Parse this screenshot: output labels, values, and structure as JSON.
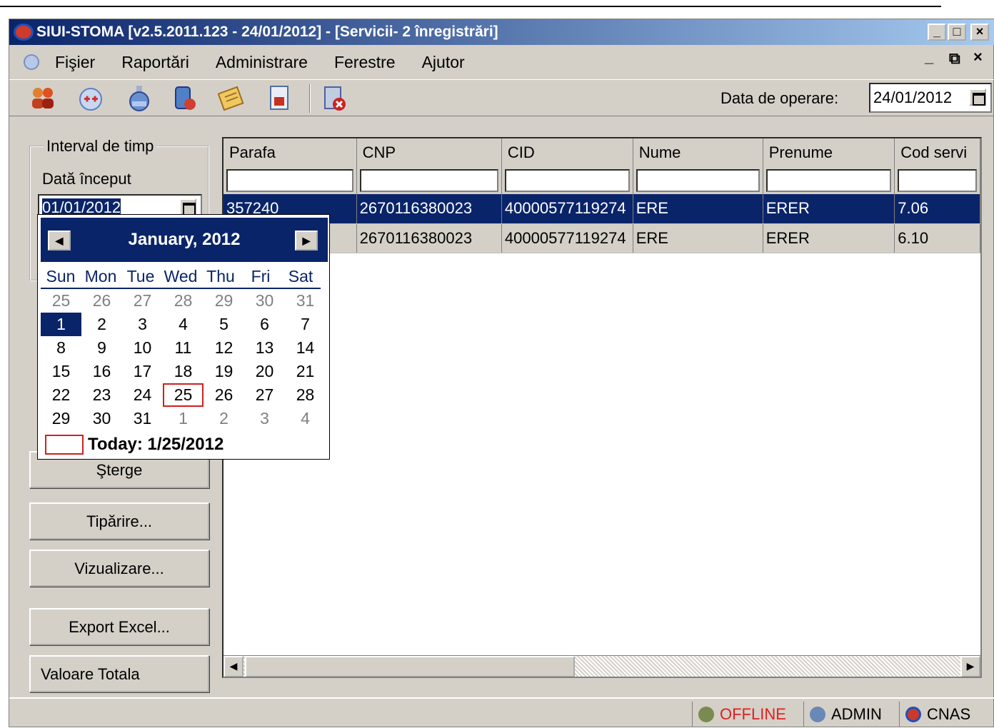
{
  "window": {
    "title": "SIUI-STOMA [v2.5.2011.123 - 24/01/2012] - [Servicii- 2 înregistrări]",
    "controls": {
      "minimize": "_",
      "maximize": "□",
      "close": "×"
    },
    "mdi_controls": {
      "minimize": "_",
      "restore": "⧉",
      "close": "×"
    }
  },
  "menu": [
    "Fişier",
    "Raportări",
    "Administrare",
    "Ferestre",
    "Ajutor"
  ],
  "toolbar": {
    "icons": [
      "users-icon",
      "medical-kit-icon",
      "bottle-icon",
      "patient-icon",
      "notes-icon",
      "document-icon",
      "delete-record-icon"
    ],
    "operation_date_label": "Data de operare:",
    "operation_date_value": "24/01/2012"
  },
  "left_panel": {
    "interval_legend": "Interval de timp",
    "start_label": "Dată început",
    "start_value": "01/01/2012",
    "buttons": {
      "delete": "Şterge",
      "print": "Tipărire...",
      "preview": "Vizualizare...",
      "export": "Export Excel...",
      "total": "Valoare Totala"
    }
  },
  "grid": {
    "columns": [
      "Parafa",
      "CNP",
      "CID",
      "Nume",
      "Prenume",
      "Cod servi"
    ],
    "rows": [
      {
        "parafa": "357240",
        "cnp": "2670116380023",
        "cid": "40000577119274",
        "nume": "ERE",
        "prenume": "ERER",
        "cod": "7.06"
      },
      {
        "parafa": "",
        "cnp": "2670116380023",
        "cid": "40000577119274",
        "nume": "ERE",
        "prenume": "ERER",
        "cod": "6.10"
      }
    ]
  },
  "calendar": {
    "month_label": "January, 2012",
    "weekdays": [
      "Sun",
      "Mon",
      "Tue",
      "Wed",
      "Thu",
      "Fri",
      "Sat"
    ],
    "weeks": [
      [
        "25",
        "26",
        "27",
        "28",
        "29",
        "30",
        "31"
      ],
      [
        "1",
        "2",
        "3",
        "4",
        "5",
        "6",
        "7"
      ],
      [
        "8",
        "9",
        "10",
        "11",
        "12",
        "13",
        "14"
      ],
      [
        "15",
        "16",
        "17",
        "18",
        "19",
        "20",
        "21"
      ],
      [
        "22",
        "23",
        "24",
        "25",
        "26",
        "27",
        "28"
      ],
      [
        "29",
        "30",
        "31",
        "1",
        "2",
        "3",
        "4"
      ]
    ],
    "today_label": "Today: 1/25/2012"
  },
  "status": {
    "connection": "OFFLINE",
    "user": "ADMIN",
    "org": "CNAS",
    "colors": {
      "offline": "#e02020"
    }
  }
}
